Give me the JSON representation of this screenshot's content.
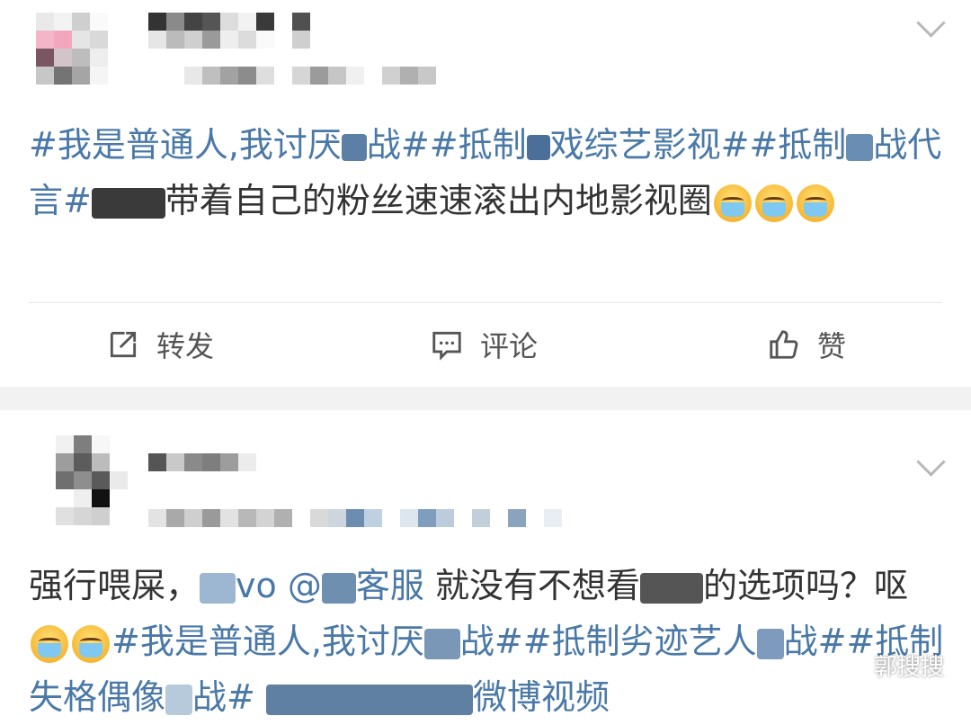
{
  "post1": {
    "text_segments": [
      {
        "type": "tag",
        "text": "#我是普通人,我讨厌"
      },
      {
        "type": "censor",
        "w": 28,
        "h": 30,
        "color": "#5c7fa6"
      },
      {
        "type": "tag",
        "text": "战##抵制"
      },
      {
        "type": "censor",
        "w": 26,
        "h": 28,
        "color": "#4b6f98"
      },
      {
        "type": "tag",
        "text": "戏综艺影视##抵制"
      },
      {
        "type": "censor",
        "w": 30,
        "h": 30,
        "color": "#6a8db4"
      },
      {
        "type": "tag",
        "text": "战代言#"
      },
      {
        "type": "censor",
        "w": 82,
        "h": 34,
        "color": "#3a3a3a"
      },
      {
        "type": "text",
        "text": "带着自己的粉丝速速滚出内地影视圈"
      },
      {
        "type": "emoji",
        "name": "vomit-emoji"
      },
      {
        "type": "emoji",
        "name": "vomit-emoji"
      },
      {
        "type": "emoji",
        "name": "vomit-emoji"
      }
    ],
    "actions": [
      {
        "label": "转发",
        "icon": "share-icon"
      },
      {
        "label": "评论",
        "icon": "comment-icon"
      },
      {
        "label": "赞",
        "icon": "thumbs-up-icon"
      }
    ]
  },
  "post2": {
    "text_segments": [
      {
        "type": "text",
        "text": "强行喂屎，"
      },
      {
        "type": "censor",
        "w": 40,
        "h": 34,
        "color": "#9db6d1"
      },
      {
        "type": "tag",
        "text": "vo @"
      },
      {
        "type": "censor",
        "w": 38,
        "h": 34,
        "color": "#6f8fb1"
      },
      {
        "type": "tag",
        "text": "客服 "
      },
      {
        "type": "text",
        "text": "就没有不想看"
      },
      {
        "type": "censor",
        "w": 70,
        "h": 34,
        "color": "#555555"
      },
      {
        "type": "text",
        "text": "的选项吗？呕"
      },
      {
        "type": "emoji",
        "name": "vomit-emoji"
      },
      {
        "type": "emoji",
        "name": "vomit-emoji"
      },
      {
        "type": "tag",
        "text": "#我是普通人,我讨厌"
      },
      {
        "type": "censor",
        "w": 40,
        "h": 34,
        "color": "#7b97b8"
      },
      {
        "type": "tag",
        "text": "战##抵制劣迹艺人"
      },
      {
        "type": "censor",
        "w": 30,
        "h": 34,
        "color": "#7e9bbd"
      },
      {
        "type": "tag",
        "text": "战##抵制失格偶像"
      },
      {
        "type": "censor",
        "w": 30,
        "h": 34,
        "color": "#b7cadc"
      },
      {
        "type": "tag",
        "text": "战# "
      },
      {
        "type": "censor",
        "w": 230,
        "h": 34,
        "color": "#5f7fa3"
      },
      {
        "type": "tag",
        "text": "微博视频"
      }
    ]
  },
  "watermark": {
    "text": "郭搜搜"
  },
  "colors": {
    "link": "#4a79a8",
    "text": "#333333",
    "action": "#555555",
    "gap": "#f2f2f2"
  }
}
